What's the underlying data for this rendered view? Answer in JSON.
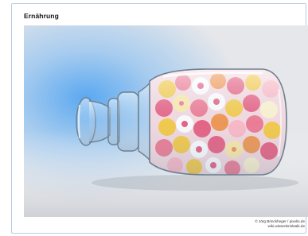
{
  "section": {
    "title": "Ernährung"
  },
  "photo": {
    "subject": "glass jar filled with wrapped candies",
    "credit_line1": "© Jörg Brinckheger / pixelio.de",
    "credit_line2": "wiki.wissenbrinktalk.de"
  },
  "colors": {
    "frame_border": "#b9cbe4",
    "backdrop_glow": "#6fb2ee",
    "backdrop_base": "#d9dbe0"
  }
}
